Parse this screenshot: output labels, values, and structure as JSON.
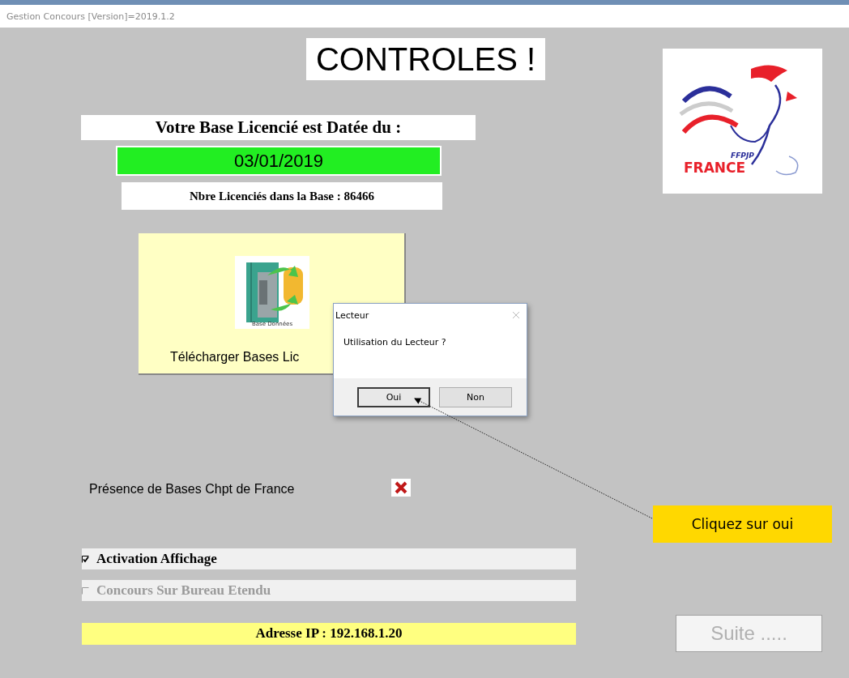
{
  "window": {
    "title": "Gestion Concours [Version]=2019.1.2"
  },
  "heading": "CONTROLES !",
  "base_info": {
    "label": "Votre Base Licencié est Datée du :",
    "date": "03/01/2019",
    "count": "Nbre Licenciés dans la Base : 86466"
  },
  "logo": {
    "org": "FFPJP",
    "country": "FRANCE"
  },
  "download_button": {
    "label": "Télécharger Bases Lic",
    "icon_caption": "Base Données"
  },
  "presence": {
    "label": "Présence de Bases Chpt de France",
    "present": false
  },
  "options": [
    {
      "label": "Activation Affichage",
      "checked": true,
      "disabled": false
    },
    {
      "label": "Concours Sur Bureau Etendu",
      "checked": false,
      "disabled": true
    }
  ],
  "ip": "Adresse IP : 192.168.1.20",
  "next_button": {
    "label": "Suite .....",
    "disabled": true
  },
  "dialog": {
    "title": "Lecteur",
    "message": "Utilisation du Lecteur ?",
    "buttons": [
      {
        "label": "Oui",
        "selected": true
      },
      {
        "label": "Non",
        "selected": false
      }
    ]
  },
  "callout": {
    "text": "Cliquez sur oui"
  }
}
